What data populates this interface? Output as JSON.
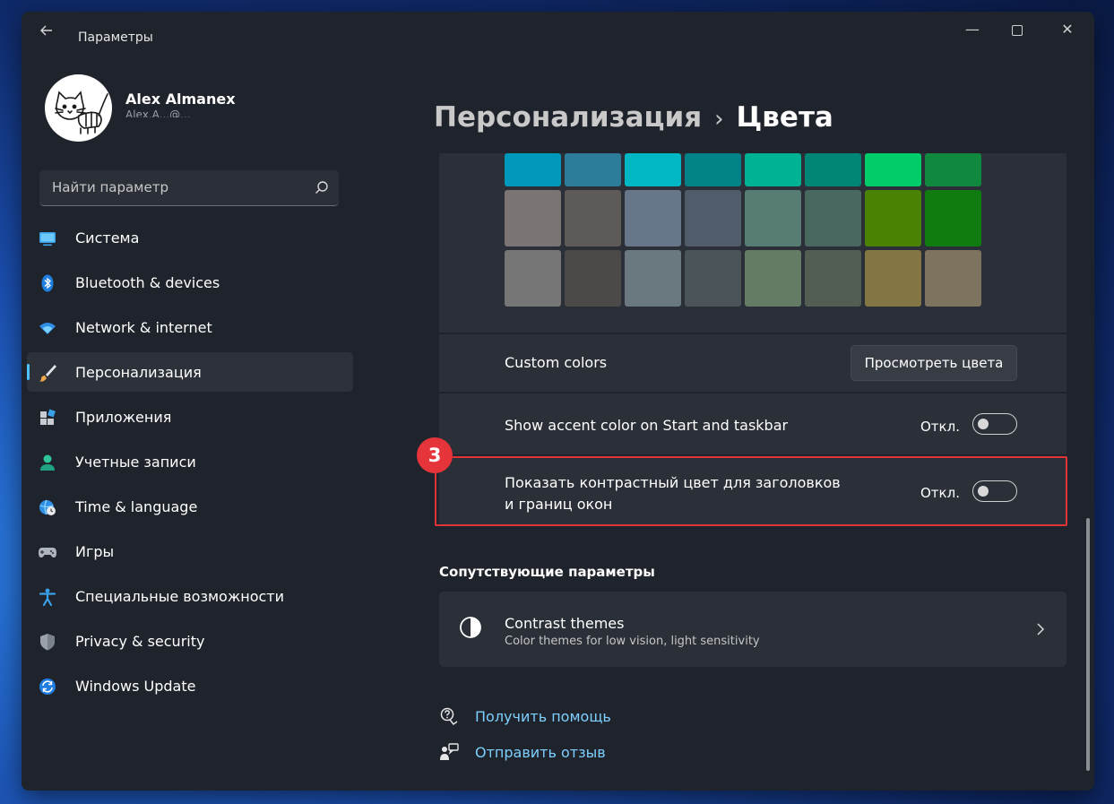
{
  "window": {
    "title": "Параметры",
    "back_icon": "arrow-left-icon",
    "controls": {
      "minimize": "—",
      "close": "✕"
    }
  },
  "profile": {
    "name": "Alex Almanex",
    "subtitle": "Alex.A...@..."
  },
  "search": {
    "placeholder": "Найти параметр"
  },
  "sidebar": {
    "items": [
      {
        "label": "Система",
        "icon": "monitor-icon",
        "active": false
      },
      {
        "label": "Bluetooth & devices",
        "icon": "bluetooth-icon",
        "active": false
      },
      {
        "label": "Network & internet",
        "icon": "wifi-icon",
        "active": false
      },
      {
        "label": "Персонализация",
        "icon": "paintbrush-icon",
        "active": true
      },
      {
        "label": "Приложения",
        "icon": "apps-icon",
        "active": false
      },
      {
        "label": "Учетные записи",
        "icon": "person-icon",
        "active": false
      },
      {
        "label": "Time & language",
        "icon": "globe-clock-icon",
        "active": false
      },
      {
        "label": "Игры",
        "icon": "gamepad-icon",
        "active": false
      },
      {
        "label": "Специальные возможности",
        "icon": "accessibility-icon",
        "active": false
      },
      {
        "label": "Privacy & security",
        "icon": "shield-icon",
        "active": false
      },
      {
        "label": "Windows Update",
        "icon": "update-icon",
        "active": false
      }
    ]
  },
  "breadcrumb": {
    "parent": "Персонализация",
    "separator": "›",
    "current": "Цвета"
  },
  "swatches": {
    "rows": [
      [
        "#0099bc",
        "#2d7d9a",
        "#00b7c3",
        "#038387",
        "#00b294",
        "#018574",
        "#00cc6a",
        "#10893e"
      ],
      [
        "#7a7574",
        "#5d5a58",
        "#68768a",
        "#515c6b",
        "#567c73",
        "#486860",
        "#498205",
        "#107c10"
      ],
      [
        "#767676",
        "#4c4a48",
        "#69797e",
        "#4a5459",
        "#647c64",
        "#525e54",
        "#847545",
        "#7e735f"
      ]
    ]
  },
  "custom_colors": {
    "label": "Custom colors",
    "button_label": "Просмотреть цвета"
  },
  "accent_start": {
    "label": "Show accent color on Start and taskbar",
    "state": "Откл.",
    "on": false
  },
  "accent_titlebars": {
    "label_line1": "Показать контрастный цвет для заголовков",
    "label_line2": "и границ окон",
    "state": "Откл.",
    "on": false
  },
  "annotation": {
    "badge": "3",
    "color": "#e5343a"
  },
  "related": {
    "title": "Сопутствующие параметры",
    "card": {
      "title": "Contrast themes",
      "subtitle": "Color themes for low vision, light sensitivity",
      "icon": "contrast-icon"
    }
  },
  "links": [
    {
      "label": "Получить помощь",
      "icon": "help-icon"
    },
    {
      "label": "Отправить отзыв",
      "icon": "feedback-icon"
    }
  ],
  "colors": {
    "accent": "#4cc2ff",
    "link": "#7dd0ff",
    "panel": "#2b2f37",
    "window": "#1f232b",
    "highlight": "#e0333a"
  }
}
